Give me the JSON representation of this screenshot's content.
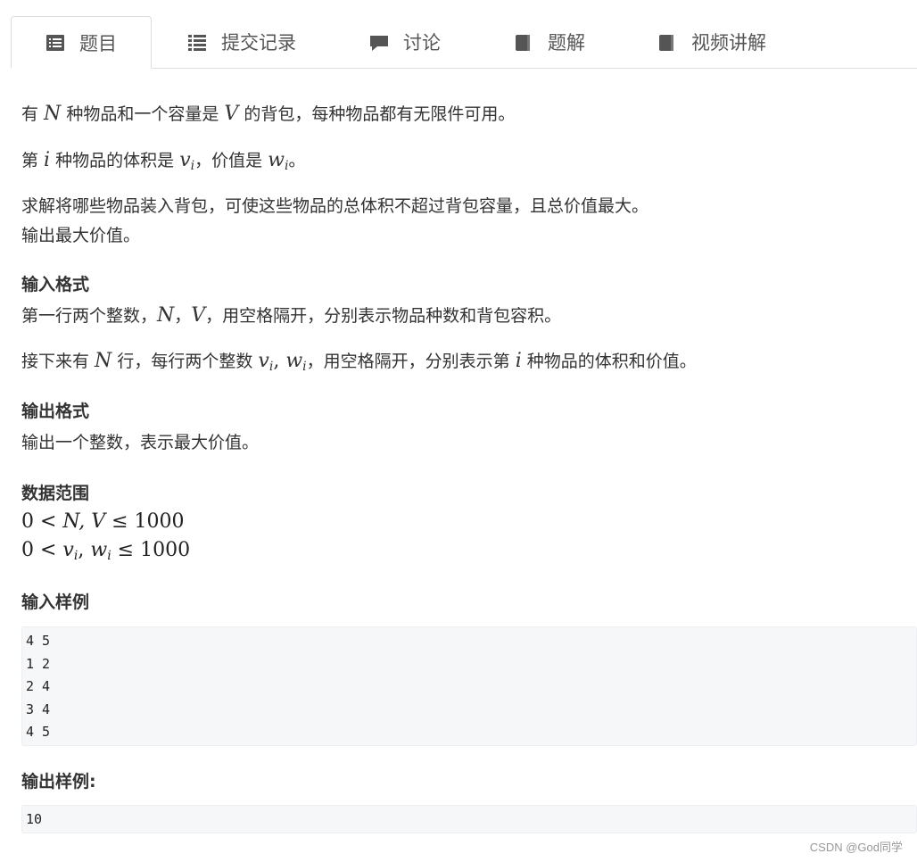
{
  "tabs": [
    {
      "label": "题目",
      "icon": "list-alt-icon",
      "active": true
    },
    {
      "label": "提交记录",
      "icon": "list-icon",
      "active": false
    },
    {
      "label": "讨论",
      "icon": "comment-icon",
      "active": false
    },
    {
      "label": "题解",
      "icon": "book-icon",
      "active": false
    },
    {
      "label": "视频讲解",
      "icon": "book-icon",
      "active": false
    }
  ],
  "problem": {
    "line1_a": "有 ",
    "line1_n": "N",
    "line1_b": " 种物品和一个容量是 ",
    "line1_v": "V",
    "line1_c": " 的背包，每种物品都有无限件可用。",
    "line2_a": "第 ",
    "line2_i": "i",
    "line2_b": " 种物品的体积是 ",
    "line2_v": "v",
    "line2_vi": "i",
    "line2_c": "，价值是 ",
    "line2_w": "w",
    "line2_wi": "i",
    "line2_d": "。",
    "line3": "求解将哪些物品装入背包，可使这些物品的总体积不超过背包容量，且总价值最大。",
    "line4": "输出最大价值。"
  },
  "input_format": {
    "title": "输入格式",
    "l1_a": "第一行两个整数，",
    "l1_n": "N",
    "l1_sep": "，",
    "l1_v": "V",
    "l1_b": "，用空格隔开，分别表示物品种数和背包容积。",
    "l2_a": "接下来有 ",
    "l2_n": "N",
    "l2_b": " 行，每行两个整数 ",
    "l2_v": "v",
    "l2_vi": "i",
    "l2_comma": ", ",
    "l2_w": "w",
    "l2_wi": "i",
    "l2_c": "，用空格隔开，分别表示第 ",
    "l2_i": "i",
    "l2_d": " 种物品的体积和价值。"
  },
  "output_format": {
    "title": "输出格式",
    "text": "输出一个整数，表示最大价值。"
  },
  "range": {
    "title": "数据范围",
    "f1_a": "0 < ",
    "f1_nv": "N, V",
    "f1_b": " ≤ 1000",
    "f2_a": "0 < ",
    "f2_v": "v",
    "f2_vi": "i",
    "f2_comma": ", ",
    "f2_w": "w",
    "f2_wi": "i",
    "f2_b": " ≤ 1000"
  },
  "sample_input": {
    "title": "输入样例",
    "lines": [
      "4 5",
      "1 2",
      "2 4",
      "3 4",
      "4 5"
    ]
  },
  "sample_output": {
    "title": "输出样例:",
    "lines": [
      "10"
    ]
  },
  "watermark": "CSDN @God同学"
}
